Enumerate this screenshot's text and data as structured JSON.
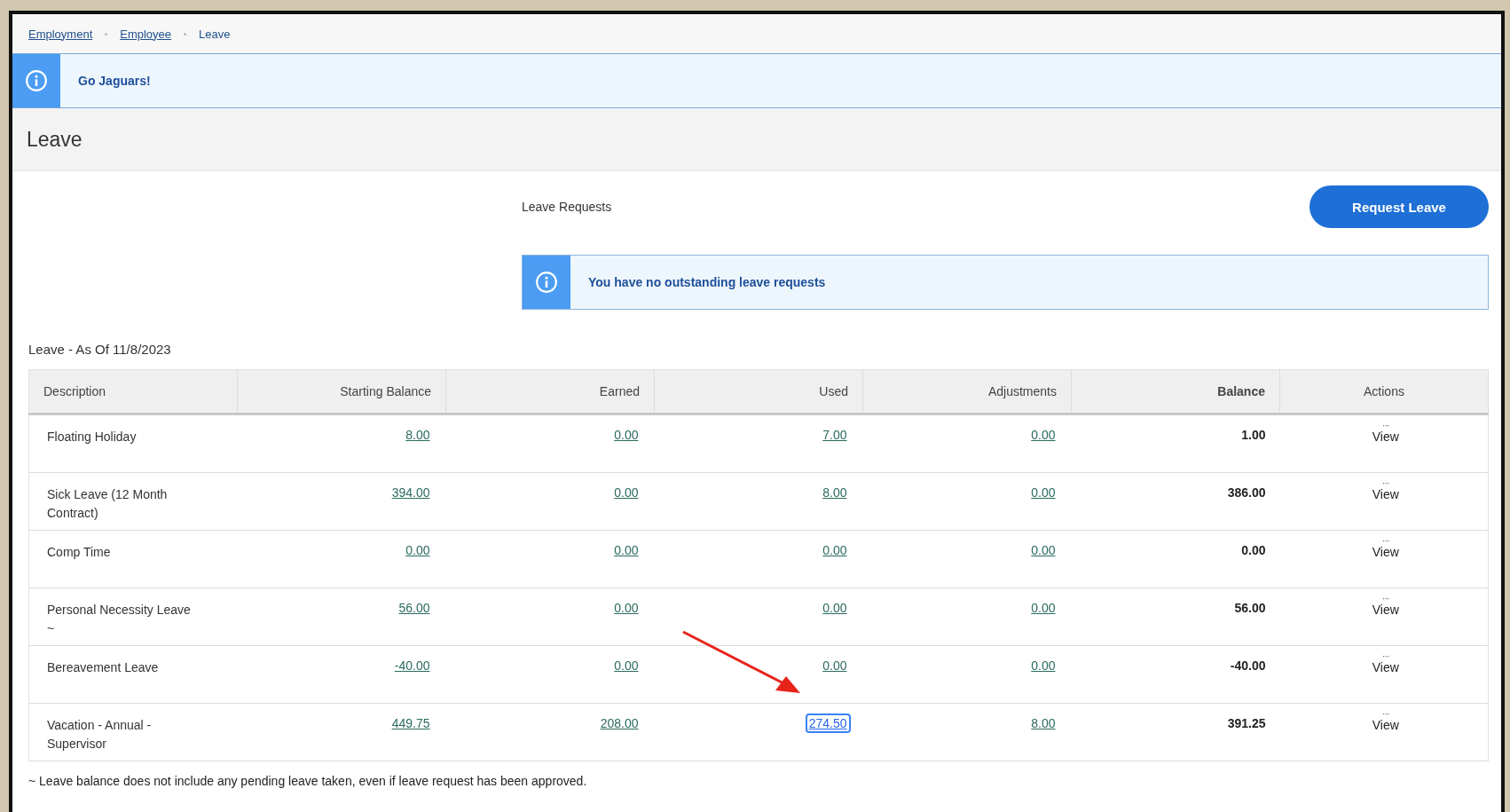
{
  "breadcrumbs": [
    {
      "label": "Employment",
      "link": true
    },
    {
      "label": "Employee",
      "link": true
    },
    {
      "label": "Leave",
      "link": false
    }
  ],
  "banner": {
    "message": "Go Jaguars!"
  },
  "page_title": "Leave",
  "leave_requests": {
    "title": "Leave Requests",
    "button": "Request Leave",
    "notice": "You have no outstanding leave requests"
  },
  "leave_table": {
    "caption": "Leave - As Of 11/8/2023",
    "columns": [
      "Description",
      "Starting Balance",
      "Earned",
      "Used",
      "Adjustments",
      "Balance",
      "Actions"
    ],
    "rows": [
      {
        "description": "Floating Holiday",
        "starting_balance": "8.00",
        "earned": "0.00",
        "used": "7.00",
        "used_focused": false,
        "adjustments": "0.00",
        "balance": "1.00",
        "menu": "···",
        "action": "View"
      },
      {
        "description": "Sick Leave (12 Month Contract)",
        "starting_balance": "394.00",
        "earned": "0.00",
        "used": "8.00",
        "used_focused": false,
        "adjustments": "0.00",
        "balance": "386.00",
        "menu": "···",
        "action": "View"
      },
      {
        "description": "Comp Time",
        "starting_balance": "0.00",
        "earned": "0.00",
        "used": "0.00",
        "used_focused": false,
        "adjustments": "0.00",
        "balance": "0.00",
        "menu": "···",
        "action": "View"
      },
      {
        "description": "Personal Necessity Leave ~",
        "starting_balance": "56.00",
        "earned": "0.00",
        "used": "0.00",
        "used_focused": false,
        "adjustments": "0.00",
        "balance": "56.00",
        "menu": "···",
        "action": "View"
      },
      {
        "description": "Bereavement Leave",
        "starting_balance": "-40.00",
        "earned": "0.00",
        "used": "0.00",
        "used_focused": false,
        "adjustments": "0.00",
        "balance": "-40.00",
        "menu": "···",
        "action": "View"
      },
      {
        "description": "Vacation - Annual - Supervisor",
        "starting_balance": "449.75",
        "earned": "208.00",
        "used": "274.50",
        "used_focused": true,
        "adjustments": "8.00",
        "balance": "391.25",
        "menu": "···",
        "action": "View"
      }
    ],
    "footnote": "~ Leave balance does not include any pending leave taken, even if leave request has been approved."
  }
}
